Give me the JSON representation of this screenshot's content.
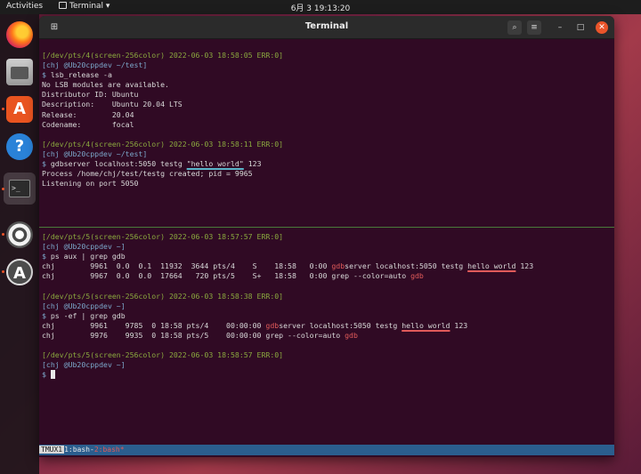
{
  "topbar": {
    "activities": "Activities",
    "app_menu": "Terminal ▾",
    "clock": "6月 3  19:13:20"
  },
  "dock": {
    "items": [
      "firefox",
      "files",
      "software",
      "help",
      "terminal",
      "settings",
      "installer"
    ],
    "software_glyph": "A",
    "help_glyph": "?",
    "terminal_glyph": ">_",
    "installer_glyph": "A"
  },
  "window": {
    "title": "Terminal",
    "search_glyph": "⌕",
    "menu_glyph": "≡",
    "minimize_glyph": "–",
    "maximize_glyph": "□",
    "close_glyph": "✕",
    "newtab_glyph": "⊞"
  },
  "pane_top": {
    "hdr1": "[/dev/pts/4(screen-256color) 2022-06-03 18:58:05 ERR:0]",
    "prompt1": "[chj @Ub20cppdev ~/test]",
    "cmd1": " lsb_release -a",
    "out1": "No LSB modules are available.",
    "out2": "Distributor ID: Ubuntu",
    "out3": "Description:    Ubuntu 20.04 LTS",
    "out4": "Release:        20.04",
    "out5": "Codename:       focal",
    "hdr2": "[/dev/pts/4(screen-256color) 2022-06-03 18:58:11 ERR:0]",
    "prompt2": "[chj @Ub20cppdev ~/test]",
    "cmd2_pre": " gdbserver localhost:5050 testg ",
    "cmd2_arg": "\"hello world\"",
    "cmd2_post": " 123",
    "out6": "Process /home/chj/test/testg created; pid = 9965",
    "out7": "Listening on port 5050"
  },
  "pane_bottom": {
    "hdr1": "[/dev/pts/5(screen-256color) 2022-06-03 18:57:57 ERR:0]",
    "prompt1": "[chj @Ub20cppdev ~]",
    "cmd1": " ps aux | grep gdb",
    "row1_pre": "chj        9961  0.0  0.1  11932  3644 pts/4    S    18:58   0:00 ",
    "row1_hl": "gdb",
    "row1_mid": "server localhost:5050 testg ",
    "row1_arg": "hello world",
    "row1_post": " 123",
    "row2_pre": "chj        9967  0.0  0.0  17664   720 pts/5    S+   18:58   0:00 grep --color=auto ",
    "row2_hl": "gdb",
    "hdr2": "[/dev/pts/5(screen-256color) 2022-06-03 18:58:38 ERR:0]",
    "prompt2": "[chj @Ub20cppdev ~]",
    "cmd2": " ps -ef | grep gdb",
    "row3_pre": "chj        9961    9785  0 18:58 pts/4    00:00:00 ",
    "row3_hl": "gdb",
    "row3_mid": "server localhost:5050 testg ",
    "row3_arg": "hello world",
    "row3_post": " 123",
    "row4_pre": "chj        9976    9935  0 18:58 pts/5    00:00:00 grep --color=auto ",
    "row4_hl": "gdb",
    "hdr3": "[/dev/pts/5(screen-256color) 2022-06-03 18:58:57 ERR:0]",
    "prompt3": "[chj @Ub20cppdev ~]",
    "dollar": "$"
  },
  "statusbar": {
    "session": "TMUX1",
    "win1": "1:bash-",
    "win2": "2:bash*"
  },
  "colors": {
    "terminal_bg": "#300a24",
    "header_green": "#8aa83e",
    "prompt_blue": "#7ba7ca",
    "highlight_red": "#e05a5a",
    "status_blue": "#2b5e8e"
  }
}
